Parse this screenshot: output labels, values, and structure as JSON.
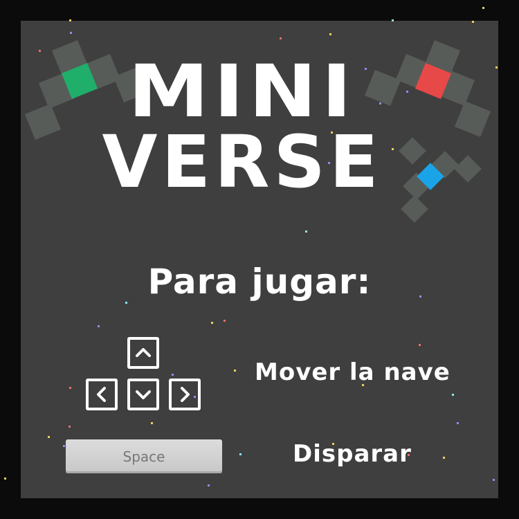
{
  "title": {
    "line1": "MINI",
    "line2": "VERSE"
  },
  "instructions": {
    "heading": "Para jugar:",
    "controls": [
      {
        "keys": [
          "up",
          "left",
          "down",
          "right"
        ],
        "description": "Mover la nave"
      },
      {
        "key_label": "Space",
        "description": "Disparar"
      }
    ]
  },
  "colors": {
    "background": "#3f3f3f",
    "border": "#0b0b0b",
    "ship_body": "#5a5e5a",
    "ship_green_core": "#1fb46e",
    "ship_red_core": "#f04a4a",
    "ship_blue_core": "#19aaf0",
    "text": "#ffffff"
  },
  "icons": [
    "ship-green-icon",
    "ship-red-icon",
    "ship-blue-icon",
    "arrow-up-icon",
    "arrow-left-icon",
    "arrow-down-icon",
    "arrow-right-icon"
  ]
}
